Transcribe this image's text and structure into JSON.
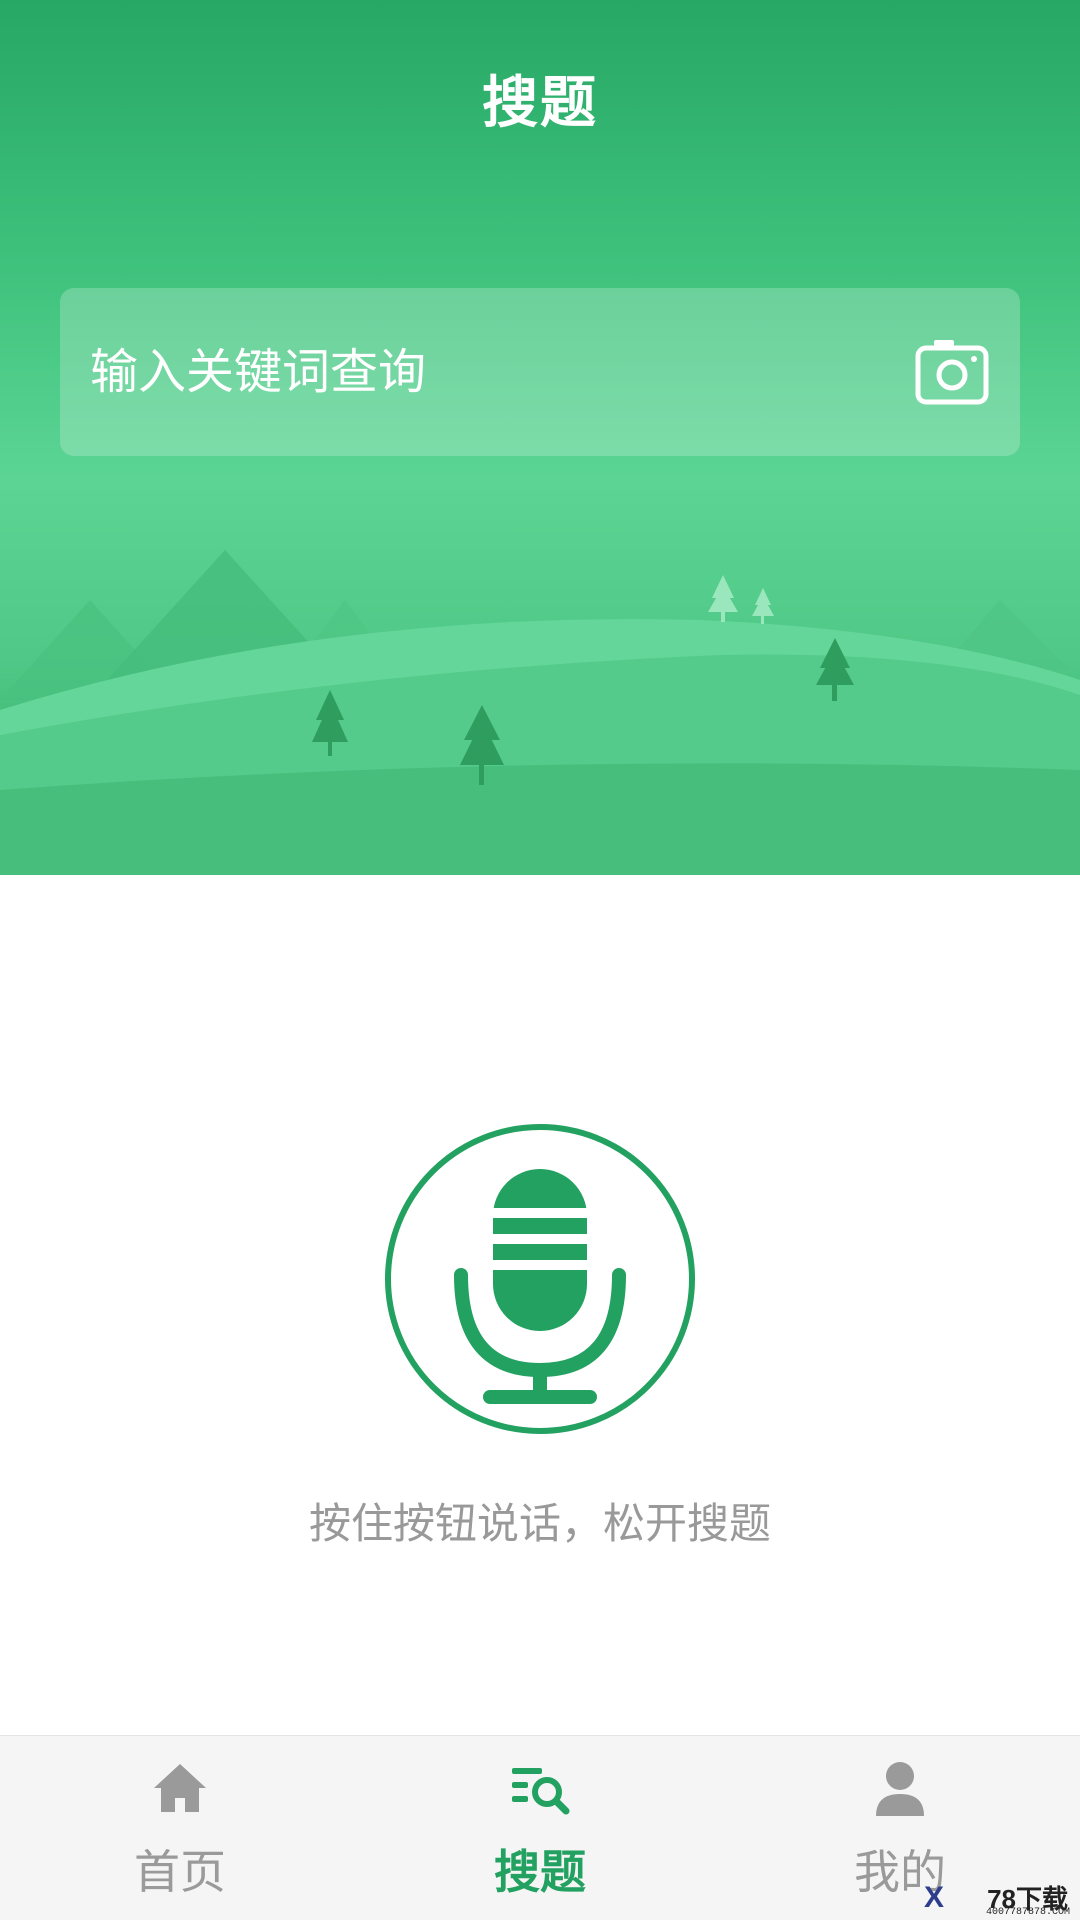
{
  "header": {
    "title": "搜题"
  },
  "search": {
    "placeholder": "输入关键词查询",
    "camera_icon": "camera-icon"
  },
  "voice": {
    "mic_icon": "microphone-icon",
    "hint": "按住按钮说话，松开搜题"
  },
  "tabbar": {
    "items": [
      {
        "label": "首页",
        "icon": "home-icon",
        "active": false
      },
      {
        "label": "搜题",
        "icon": "search-list-icon",
        "active": true
      },
      {
        "label": "我的",
        "icon": "user-icon",
        "active": false
      }
    ]
  },
  "watermark": {
    "brand": "78下载",
    "site": "4007787878.COM",
    "mark": "X"
  },
  "colors": {
    "primary_green": "#22a160",
    "header_green_top": "#27a865",
    "header_green_mid": "#5cd594",
    "inactive_gray": "#9a9a9a",
    "hint_gray": "#999999",
    "tabbar_bg": "#f5f5f5"
  }
}
